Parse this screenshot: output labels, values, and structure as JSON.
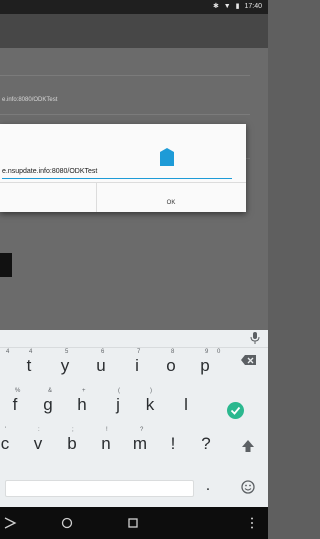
{
  "status_bar": {
    "bluetooth_icon": "bluetooth-icon",
    "wifi_icon": "wifi-icon",
    "battery_icon": "battery-icon",
    "time": "17:40"
  },
  "content": {
    "server_url_partial": "e.info:8080/ODKTest"
  },
  "dialog": {
    "input_value": "e.nsupdate.info:8080/ODKTest",
    "ok_label": "OK"
  },
  "keyboard": {
    "row1": [
      {
        "key": "t",
        "hint": "4"
      },
      {
        "key": "y",
        "hint": "5"
      },
      {
        "key": "u",
        "hint": "6"
      },
      {
        "key": "i",
        "hint": "7"
      },
      {
        "key": "o",
        "hint": "8"
      },
      {
        "key": "p",
        "hint": "9"
      }
    ],
    "row1_extra_hint": "0",
    "row2": [
      {
        "key": "f",
        "hint": "%"
      },
      {
        "key": "g",
        "hint": "&"
      },
      {
        "key": "h",
        "hint": "+"
      },
      {
        "key": "j",
        "hint": "("
      },
      {
        "key": "k",
        "hint": ")"
      },
      {
        "key": "l",
        "hint": ""
      }
    ],
    "row3": [
      {
        "key": "c",
        "hint": "'"
      },
      {
        "key": "v",
        "hint": ":"
      },
      {
        "key": "b",
        "hint": ";"
      },
      {
        "key": "n",
        "hint": "!"
      },
      {
        "key": "m",
        "hint": "?"
      },
      {
        "key": "!",
        "hint": ""
      },
      {
        "key": "?",
        "hint": ""
      }
    ],
    "period": "."
  },
  "colors": {
    "accent": "#1e9bd7",
    "enter": "#2bb88f"
  }
}
